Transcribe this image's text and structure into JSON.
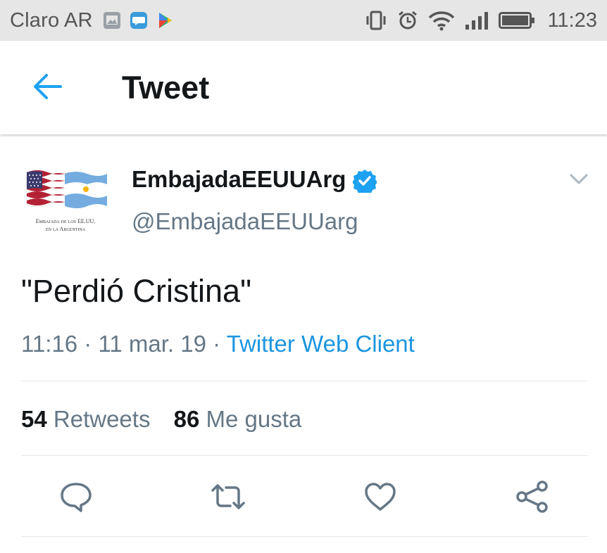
{
  "status_bar": {
    "carrier": "Claro AR",
    "time": "11:23",
    "left_icons": [
      "gallery-icon",
      "message-icon",
      "play-store-icon"
    ],
    "right_icons": [
      "vibrate-icon",
      "alarm-icon",
      "wifi-icon",
      "signal-icon",
      "battery-icon"
    ]
  },
  "header": {
    "title": "Tweet",
    "back_icon": "back-arrow-icon",
    "accent_color": "#1da1f2"
  },
  "tweet": {
    "avatar_caption_line1": "Embajada de los EE.UU.",
    "avatar_caption_line2": "en la Argentina",
    "display_name": "EmbajadaEEUUArg",
    "verified": true,
    "username": "@EmbajadaEEUUarg",
    "text": "\"Perdió Cristina\"",
    "time": "11:16",
    "separator": " · ",
    "date": "11 mar. 19",
    "source": "Twitter Web Client",
    "link_color": "#1b95e0"
  },
  "stats": {
    "retweets_count": "54",
    "retweets_label": "Retweets",
    "likes_count": "86",
    "likes_label": "Me gusta"
  },
  "actions": [
    "reply-icon",
    "retweet-icon",
    "like-icon",
    "share-icon"
  ]
}
